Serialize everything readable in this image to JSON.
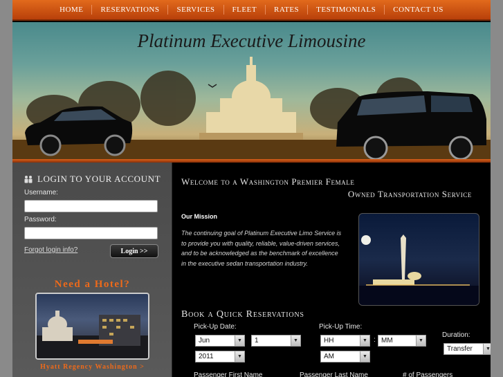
{
  "nav": {
    "items": [
      "HOME",
      "RESERVATIONS",
      "SERVICES",
      "FLEET",
      "RATES",
      "TESTIMONIALS",
      "CONTACT US"
    ]
  },
  "hero": {
    "title": "Platinum Executive Limousine"
  },
  "login": {
    "heading": "Login to your account",
    "username_label": "Username:",
    "username_value": "",
    "password_label": "Password:",
    "password_value": "",
    "forgot_link": "Forgot login info?",
    "button_label": "Login >>"
  },
  "hotel": {
    "heading": "Need a Hotel?",
    "link": "Hyatt Regency Washington >"
  },
  "welcome": {
    "line1": "Welcome to a Washington Premier Female",
    "line2": "Owned Transportation Service"
  },
  "mission": {
    "title": "Our Mission",
    "text": "The continuing goal of Platinum Executive Limo Service is to provide you with quality, reliable, value-driven services, and to be acknowledged as the benchmark of excellence in the executive sedan transportation industry."
  },
  "booking": {
    "title": "Book a Quick Reservations",
    "pickup_date_label": "Pick-Up Date:",
    "month": "Jun",
    "day": "1",
    "year": "2011",
    "pickup_time_label": "Pick-Up Time:",
    "hour": "HH",
    "minute": "MM",
    "ampm": "AM",
    "duration_label": "Duration:",
    "duration": "Transfer",
    "first_name_label": "Passenger First Name",
    "last_name_label": "Passenger Last Name",
    "passengers_label": "# of Passengers"
  },
  "colors": {
    "accent": "#e26a1c",
    "background": "#000000"
  }
}
